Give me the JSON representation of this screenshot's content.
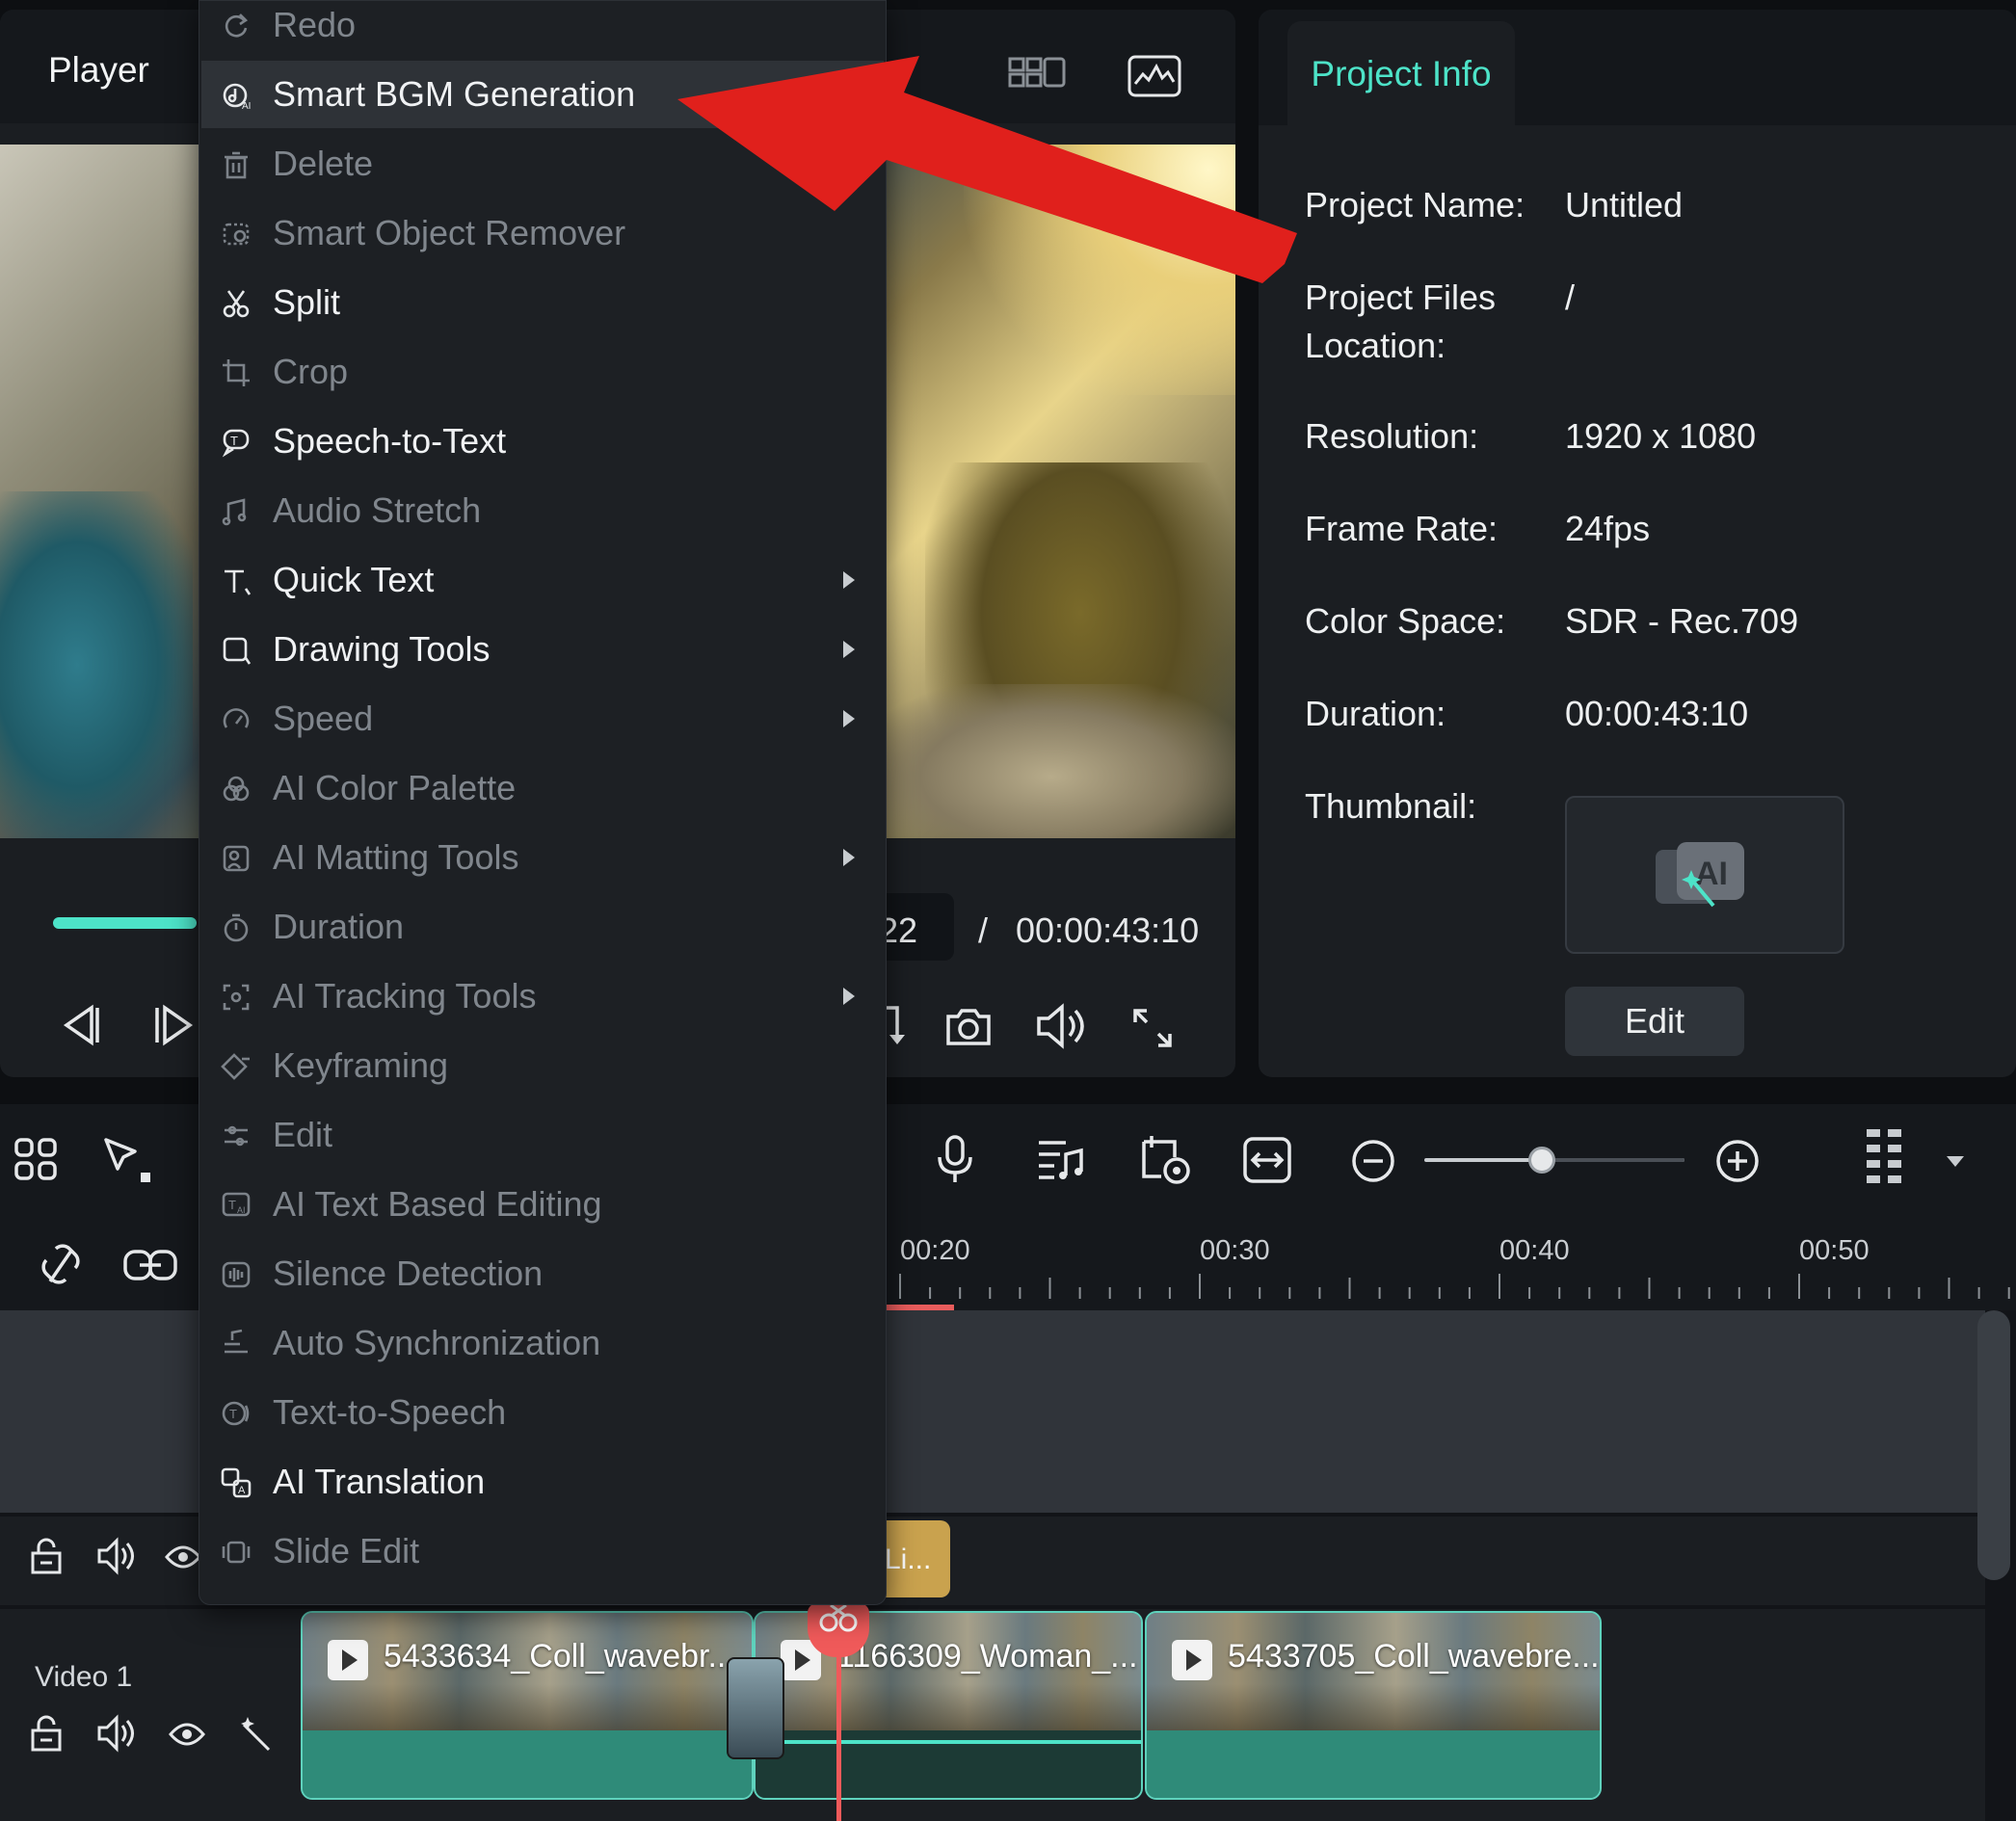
{
  "player": {
    "title": "Player",
    "time_current": "22",
    "time_separator": "/",
    "time_total": "00:00:43:10",
    "progress_fraction": 0.16
  },
  "project_info": {
    "tab_label": "Project Info",
    "rows": [
      {
        "label": "Project Name:",
        "value": "Untitled"
      },
      {
        "label": "Project Files Location:",
        "value": "/"
      },
      {
        "label": "Resolution:",
        "value": "1920 x 1080"
      },
      {
        "label": "Frame Rate:",
        "value": "24fps"
      },
      {
        "label": "Color Space:",
        "value": "SDR - Rec.709"
      },
      {
        "label": "Duration:",
        "value": "00:00:43:10"
      },
      {
        "label": "Thumbnail:",
        "value": ""
      }
    ],
    "thumbnail_badge": "AI",
    "edit_button": "Edit"
  },
  "context_menu": {
    "items": [
      {
        "label": "Redo",
        "icon": "redo-icon",
        "enabled": false,
        "submenu": false,
        "highlighted": false
      },
      {
        "label": "Smart BGM Generation",
        "icon": "ai-music-icon",
        "enabled": true,
        "submenu": false,
        "highlighted": true
      },
      {
        "label": "Delete",
        "icon": "trash-icon",
        "enabled": false,
        "submenu": false,
        "highlighted": false
      },
      {
        "label": "Smart Object Remover",
        "icon": "object-remover-icon",
        "enabled": false,
        "submenu": false,
        "highlighted": false
      },
      {
        "label": "Split",
        "icon": "scissors-icon",
        "enabled": true,
        "submenu": false,
        "highlighted": false
      },
      {
        "label": "Crop",
        "icon": "crop-icon",
        "enabled": false,
        "submenu": false,
        "highlighted": false
      },
      {
        "label": "Speech-to-Text",
        "icon": "speech-to-text-icon",
        "enabled": true,
        "submenu": false,
        "highlighted": false
      },
      {
        "label": "Audio Stretch",
        "icon": "audio-stretch-icon",
        "enabled": false,
        "submenu": false,
        "highlighted": false
      },
      {
        "label": "Quick Text",
        "icon": "text-icon",
        "enabled": true,
        "submenu": true,
        "highlighted": false
      },
      {
        "label": "Drawing Tools",
        "icon": "drawing-icon",
        "enabled": true,
        "submenu": true,
        "highlighted": false
      },
      {
        "label": "Speed",
        "icon": "speed-icon",
        "enabled": false,
        "submenu": true,
        "highlighted": false
      },
      {
        "label": "AI Color Palette",
        "icon": "palette-icon",
        "enabled": false,
        "submenu": false,
        "highlighted": false
      },
      {
        "label": "AI Matting Tools",
        "icon": "matting-icon",
        "enabled": false,
        "submenu": true,
        "highlighted": false
      },
      {
        "label": "Duration",
        "icon": "timer-icon",
        "enabled": false,
        "submenu": false,
        "highlighted": false
      },
      {
        "label": "AI Tracking Tools",
        "icon": "tracking-icon",
        "enabled": false,
        "submenu": true,
        "highlighted": false
      },
      {
        "label": "Keyframing",
        "icon": "keyframe-icon",
        "enabled": false,
        "submenu": false,
        "highlighted": false
      },
      {
        "label": "Edit",
        "icon": "sliders-icon",
        "enabled": false,
        "submenu": false,
        "highlighted": false
      },
      {
        "label": "AI Text Based Editing",
        "icon": "text-edit-icon",
        "enabled": false,
        "submenu": false,
        "highlighted": false
      },
      {
        "label": "Silence Detection",
        "icon": "waveform-icon",
        "enabled": false,
        "submenu": false,
        "highlighted": false
      },
      {
        "label": "Auto Synchronization",
        "icon": "sync-icon",
        "enabled": false,
        "submenu": false,
        "highlighted": false
      },
      {
        "label": "Text-to-Speech",
        "icon": "text-to-speech-icon",
        "enabled": false,
        "submenu": false,
        "highlighted": false
      },
      {
        "label": "AI Translation",
        "icon": "translate-icon",
        "enabled": true,
        "submenu": false,
        "highlighted": false
      },
      {
        "label": "Slide Edit",
        "icon": "slide-edit-icon",
        "enabled": false,
        "submenu": false,
        "highlighted": false
      }
    ]
  },
  "timeline": {
    "ruler_labels": [
      "00:20",
      "00:30",
      "00:40",
      "00:50"
    ],
    "zoom_level_fraction": 0.45,
    "audio_clip_label": "Li...",
    "video_track_label": "Video 1",
    "clips": [
      {
        "name": "5433634_Coll_wavebr..."
      },
      {
        "name": "1166309_Woman_..."
      },
      {
        "name": "5433705_Coll_wavebre..."
      }
    ]
  },
  "colors": {
    "accent": "#4de3c8",
    "playhead": "#f05a5a",
    "annotation_arrow": "#e0201c",
    "audio_clip": "#c9a24e"
  }
}
